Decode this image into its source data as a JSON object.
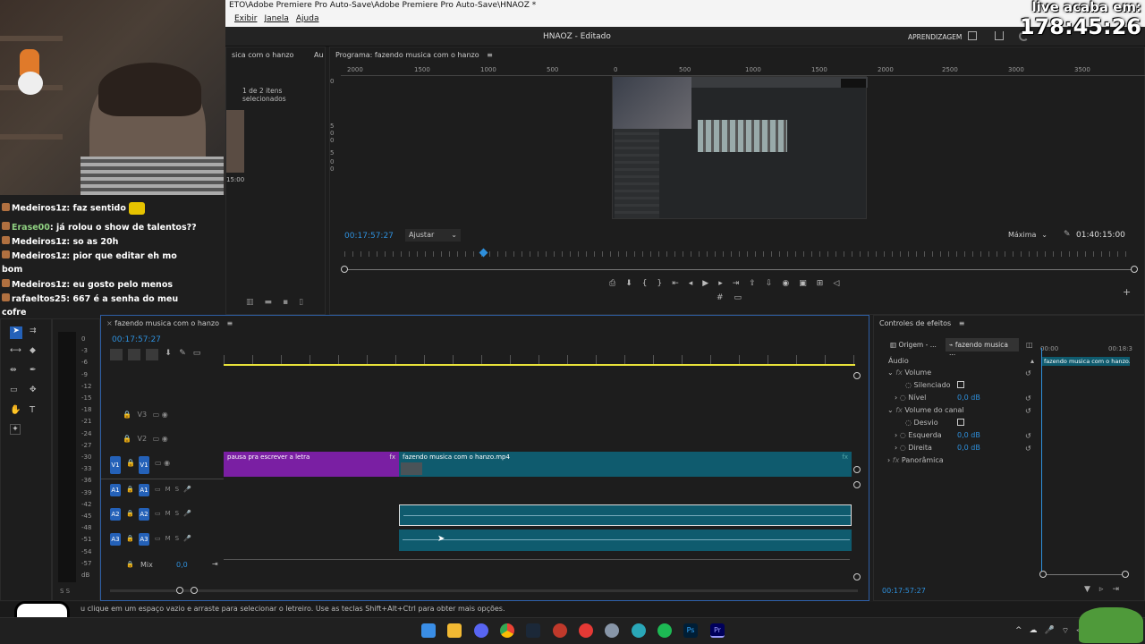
{
  "window": {
    "title": "ETO\\Adobe Premiere Pro Auto-Save\\Adobe Premiere Pro Auto-Save\\HNAOZ *"
  },
  "menu": [
    "Exibir",
    "Janela",
    "Ajuda"
  ],
  "appbar": {
    "project": "HNAOZ - Editado",
    "workspace": "APRENDIZAGEM"
  },
  "overlay": {
    "line1": "live acaba em:",
    "line2": "178:45:26"
  },
  "project_panel": {
    "title": "sica com o hanzo",
    "tab2": "Au",
    "selection": "1 de 2 itens selecionados",
    "duration": "15:00"
  },
  "chat": [
    {
      "user": "Medeiros1z",
      "msg": "faz sentido",
      "green": false
    },
    {
      "user": "Erase00",
      "msg": "já rolou o show de talentos??",
      "green": true
    },
    {
      "user": "Medeiros1z",
      "msg": "so as 20h",
      "green": false
    },
    {
      "user": "Medeiros1z",
      "msg": "pior que editar eh mo",
      "green": false
    },
    {
      "user": "",
      "msg": "bom",
      "green": false
    },
    {
      "user": "Medeiros1z",
      "msg": "eu gosto pelo menos",
      "green": false
    },
    {
      "user": "rafaeltos25",
      "msg": "667 é a senha do meu",
      "green": false
    },
    {
      "user": "",
      "msg": "cofre",
      "green": false
    }
  ],
  "program": {
    "title": "Programa: fazendo musica com o hanzo",
    "ruler": [
      "2000",
      "1500",
      "1000",
      "500",
      "0",
      "500",
      "1000",
      "1500",
      "2000",
      "2500",
      "3000",
      "3500"
    ],
    "vruler": [
      "0",
      "5",
      "0",
      "0",
      "5",
      "0",
      "0"
    ],
    "timecode": "00:17:57:27",
    "fit": "Ajustar",
    "quality": "Máxima",
    "duration": "01:40:15:00"
  },
  "timeline": {
    "title": "fazendo musica com o hanzo",
    "timecode": "00:17:57:27",
    "tracks_video": [
      "V3",
      "V2",
      "V1"
    ],
    "tracks_audio": [
      "A1",
      "A2",
      "A3"
    ],
    "mix_label": "Mix",
    "mix_value": "0,0",
    "clip_purple": "pausa pra escrever a letra",
    "clip_teal": "fazendo musica com o hanzo.mp4",
    "fx": "fx"
  },
  "meter_scale": [
    "0",
    "-3",
    "-6",
    "-9",
    "-12",
    "-15",
    "-18",
    "-21",
    "-24",
    "-27",
    "-30",
    "-33",
    "-36",
    "-39",
    "-42",
    "-45",
    "-48",
    "-51",
    "-54",
    "-57",
    "dB"
  ],
  "meter_bottom": "S S",
  "effects": {
    "title": "Controles de efeitos",
    "tab_origin": "Origem - ...",
    "tab_seq": "fazendo musica ...",
    "time_start": "00:00",
    "time_end": "00:18:3",
    "clip_label": "fazendo musica com o hanzo.mp4",
    "section": "Áudio",
    "rows": [
      {
        "name": "Volume",
        "value": "",
        "indent": 0
      },
      {
        "name": "Silenciado",
        "value": "",
        "indent": 1
      },
      {
        "name": "Nível",
        "value": "0,0 dB",
        "indent": 1
      },
      {
        "name": "Volume do canal",
        "value": "",
        "indent": 0
      },
      {
        "name": "Desvio",
        "value": "",
        "indent": 1
      },
      {
        "name": "Esquerda",
        "value": "0,0 dB",
        "indent": 1
      },
      {
        "name": "Direita",
        "value": "0,0 dB",
        "indent": 1
      },
      {
        "name": "Panorâmica",
        "value": "",
        "indent": 0
      }
    ],
    "footer_time": "00:17:57:27"
  },
  "status": "u clique em um espaço vazio e arraste para selecionar o letreiro. Use as teclas Shift+Alt+Ctrl para obter mais opções.",
  "colors": {
    "accent": "#2e8fdb",
    "purple": "#7a1fa3",
    "teal": "#0f5b6e",
    "trackblue": "#2461b8",
    "playhead": "#e8e23a"
  }
}
